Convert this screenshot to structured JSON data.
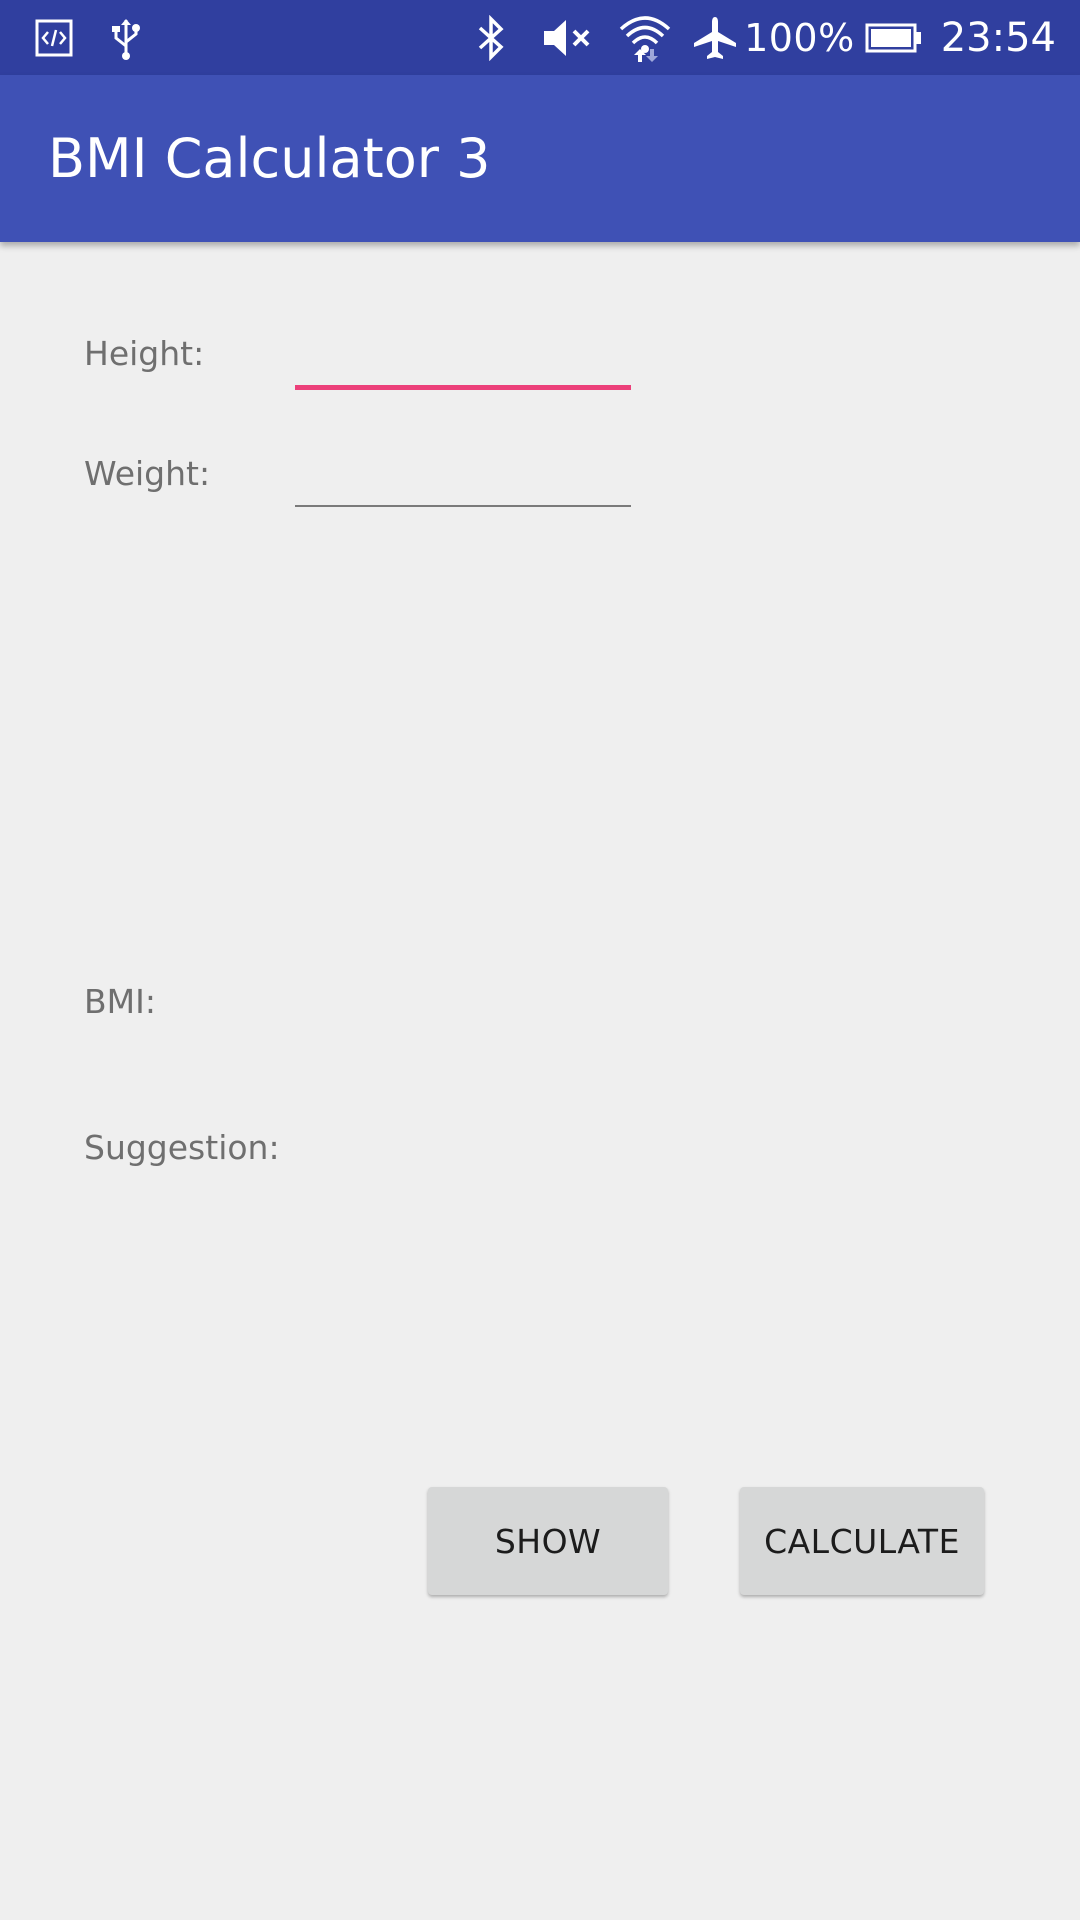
{
  "status_bar": {
    "icons_left": [
      "code-icon",
      "usb-icon"
    ],
    "icons_right": [
      "bluetooth-icon",
      "mute-icon",
      "wifi-icon",
      "airplane-icon"
    ],
    "battery_percent": "100%",
    "time": "23:54"
  },
  "app_bar": {
    "title": "BMI Calculator 3"
  },
  "form": {
    "height_label": "Height:",
    "height_value": "",
    "weight_label": "Weight:",
    "weight_value": ""
  },
  "results": {
    "bmi_label": "BMI:",
    "suggestion_label": "Suggestion:"
  },
  "buttons": {
    "show_label": "SHOW",
    "calculate_label": "CALCULATE"
  },
  "colors": {
    "status_bar": "#303f9f",
    "app_bar": "#3f51b5",
    "accent": "#ec407a",
    "background": "#efefef"
  }
}
